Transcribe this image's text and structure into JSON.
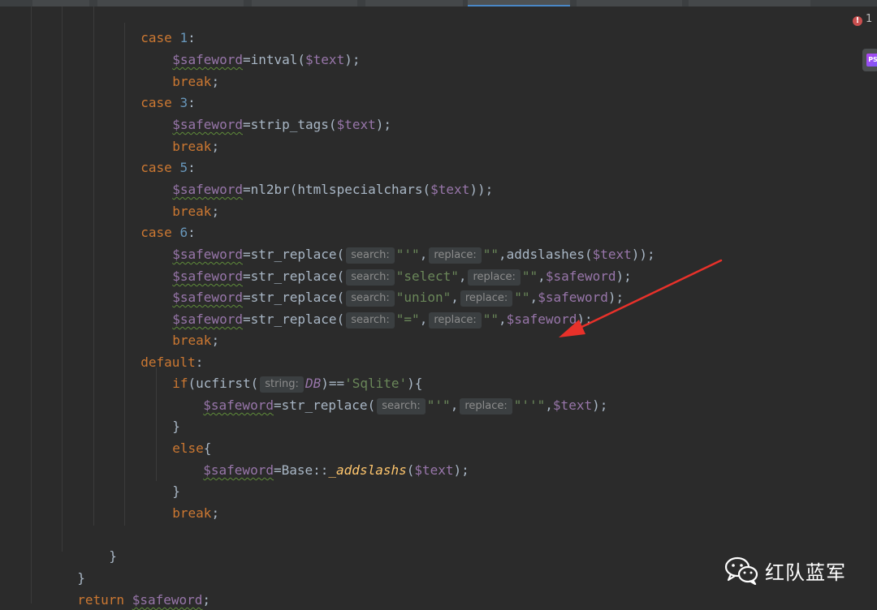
{
  "lines": {
    "l1": {
      "kw": "case",
      "num": "1",
      "punc": ":"
    },
    "l2": {
      "var": "$safeword",
      "a": "=intval(",
      "v2": "$text",
      "b": ");"
    },
    "l3": {
      "kw": "break",
      "punc": ";"
    },
    "l4": {
      "kw": "case",
      "num": "3",
      "punc": ":"
    },
    "l5": {
      "var": "$safeword",
      "a": "=strip_tags(",
      "v2": "$text",
      "b": ");"
    },
    "l6": {
      "kw": "break",
      "punc": ";"
    },
    "l7": {
      "kw": "case",
      "num": "5",
      "punc": ":"
    },
    "l8": {
      "var": "$safeword",
      "a": "=nl2br(htmlspecialchars(",
      "v2": "$text",
      "b": "));"
    },
    "l9": {
      "kw": "break",
      "punc": ";"
    },
    "l10": {
      "kw": "case",
      "num": "6",
      "punc": ":"
    },
    "l11": {
      "var": "$safeword",
      "a": "=str_replace(",
      "h1": "search:",
      "s1": "\"'\"",
      "c1": ",",
      "h2": "replace:",
      "s2": "\"\"",
      "c2": ",addslashes(",
      "v2": "$text",
      "b": "));"
    },
    "l12": {
      "var": "$safeword",
      "a": "=str_replace(",
      "h1": "search:",
      "s1": "\"select\"",
      "c1": ",",
      "h2": "replace:",
      "s2": "\"\"",
      "c2": ",",
      "v2": "$safeword",
      "b": ");"
    },
    "l13": {
      "var": "$safeword",
      "a": "=str_replace(",
      "h1": "search:",
      "s1": "\"union\"",
      "c1": ",",
      "h2": "replace:",
      "s2": "\"\"",
      "c2": ",",
      "v2": "$safeword",
      "b": ");"
    },
    "l14": {
      "var": "$safeword",
      "a": "=str_replace(",
      "h1": "search:",
      "s1": "\"=\"",
      "c1": ",",
      "h2": "replace:",
      "s2": "\"\"",
      "c2": ",",
      "v2": "$safeword",
      "b": ");"
    },
    "l15": {
      "kw": "break",
      "punc": ";"
    },
    "l16": {
      "kw": "default",
      "punc": ":"
    },
    "l17": {
      "kw": "if",
      "a": "(ucfirst(",
      "h1": "string:",
      "c": "DB",
      "b": ")==",
      "s1": "'Sqlite'",
      "d": "){"
    },
    "l18": {
      "var": "$safeword",
      "a": "=str_replace(",
      "h1": "search:",
      "s1": "\"'\"",
      "c1": ",",
      "h2": "replace:",
      "s2": "\"''\"",
      "c2": ",",
      "v2": "$text",
      "b": ");"
    },
    "l19": {
      "punc": "}"
    },
    "l20": {
      "kw": "else",
      "punc": "{"
    },
    "l21": {
      "var": "$safeword",
      "a": "=Base::",
      "m": "_addslashs",
      "b": "(",
      "v2": "$text",
      "c": ");"
    },
    "l22": {
      "punc": "}"
    },
    "l23": {
      "kw": "break",
      "punc": ";"
    },
    "l24": {
      "punc": "}"
    },
    "l25": {
      "punc": "}"
    },
    "l26": {
      "kw": "return",
      "var": "$safeword",
      "punc": ";"
    },
    "l27": {
      "punc": "}"
    }
  },
  "status": {
    "error_count": "1",
    "error_icon": "error-icon",
    "plugin_icon": "phpstorm-icon",
    "plugin_label": "PS"
  },
  "watermark": {
    "icon": "wechat-icon",
    "text": "红队蓝军"
  },
  "annotation": {
    "type": "red-arrow",
    "color": "#e8312a"
  },
  "colors": {
    "background": "#2b2b2b",
    "keyword": "#cc7832",
    "number": "#6897bb",
    "variable": "#9876aa",
    "string": "#6a8759",
    "text": "#a9b7c6"
  }
}
